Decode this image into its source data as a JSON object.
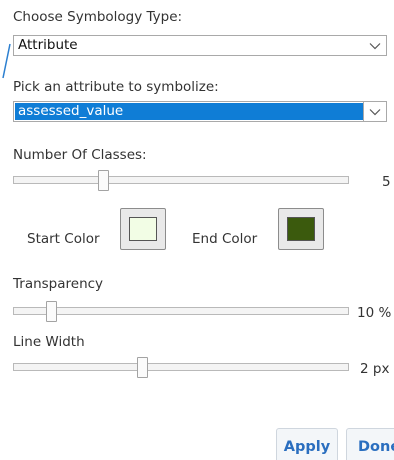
{
  "symbology": {
    "type_label": "Choose Symbology Type:",
    "type_value": "Attribute",
    "attribute_label": "Pick an attribute to symbolize:",
    "attribute_value": "assessed_value"
  },
  "classes": {
    "label": "Number Of Classes:",
    "value": "5",
    "level": 0.26
  },
  "colors": {
    "start_label": "Start Color",
    "start_value": "#f2fde5",
    "end_label": "End Color",
    "end_value": "#3b5a0d"
  },
  "transparency": {
    "label": "Transparency",
    "value": "10 %",
    "level": 0.1
  },
  "line_width": {
    "label": "Line Width",
    "value": "2 px",
    "level": 0.38
  },
  "actions": {
    "apply_label": "Apply",
    "done_label": "Done"
  },
  "theme": {
    "accent": "#0f7dd6",
    "button_text": "#2a6ebf"
  }
}
